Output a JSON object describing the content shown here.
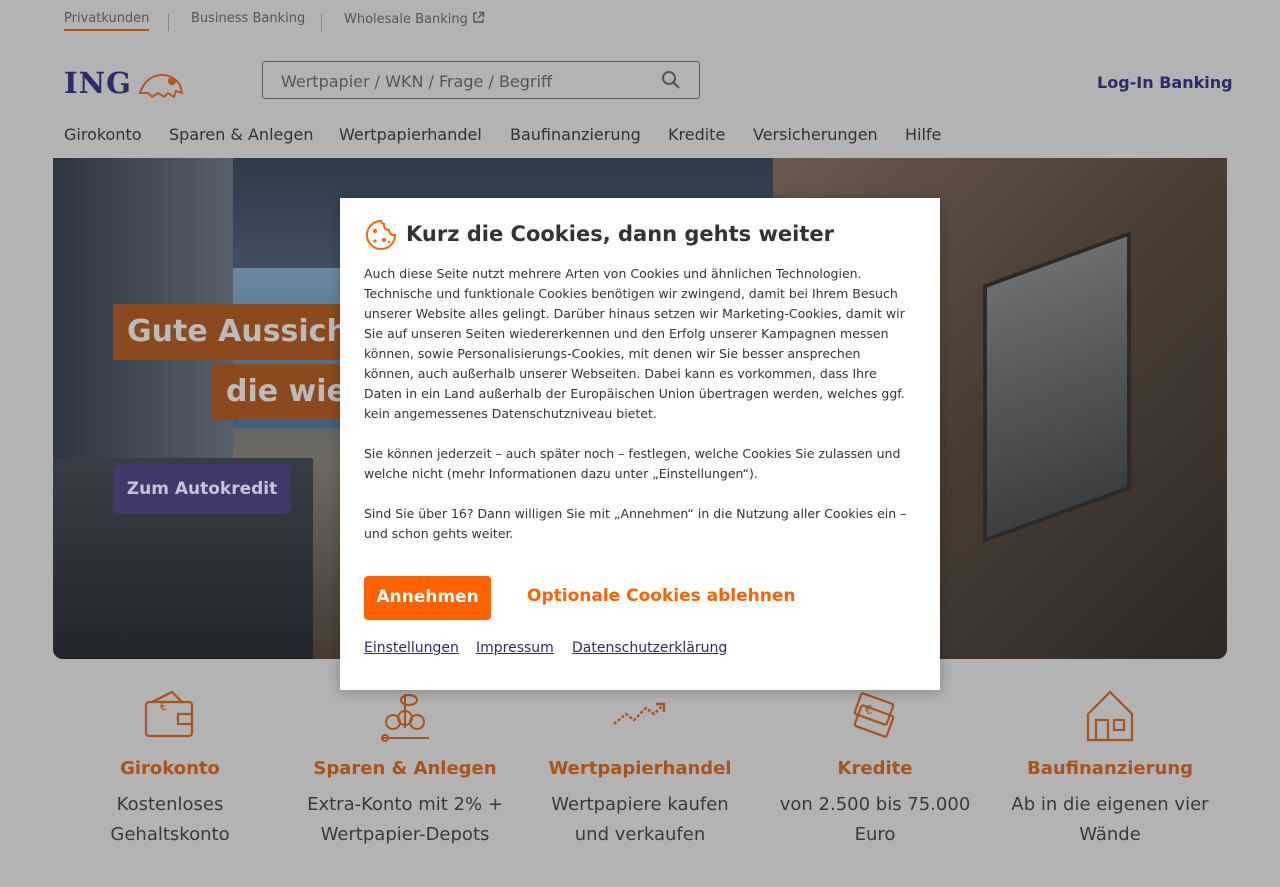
{
  "segments": {
    "items": [
      {
        "label": "Privatkunden"
      },
      {
        "label": "Business Banking"
      },
      {
        "label": "Wholesale Banking"
      }
    ]
  },
  "header": {
    "logo_text": "ING",
    "search_placeholder": "Wertpapier / WKN / Frage / Begriff",
    "login_label": "Log-In Banking"
  },
  "nav": {
    "items": [
      {
        "label": "Girokonto"
      },
      {
        "label": "Sparen & Anlegen"
      },
      {
        "label": "Wertpapierhandel"
      },
      {
        "label": "Baufinanzierung"
      },
      {
        "label": "Kredite"
      },
      {
        "label": "Versicherungen"
      },
      {
        "label": "Hilfe"
      }
    ]
  },
  "hero": {
    "headline_line1": "Gute Aussicht",
    "headline_line2": "die wie",
    "cta_label": "Zum Autokredit"
  },
  "products": [
    {
      "title": "Girokonto",
      "desc": "Kostenloses Gehaltskonto",
      "icon": "wallet-euro-icon"
    },
    {
      "title": "Sparen & Anlegen",
      "desc": "Extra-Konto mit 2% + Wertpapier-Depots",
      "icon": "savings-plant-icon"
    },
    {
      "title": "Wertpapierhandel",
      "desc": "Wertpapiere kaufen und verkaufen",
      "icon": "trend-up-icon"
    },
    {
      "title": "Kredite",
      "desc": "von 2.500 bis 75.000 Euro",
      "icon": "banknotes-icon"
    },
    {
      "title": "Baufinanzierung",
      "desc": "Ab in die eigenen vier Wände",
      "icon": "house-icon"
    }
  ],
  "cookie_modal": {
    "title": "Kurz die Cookies, dann gehts weiter",
    "paragraph1": "Auch diese Seite nutzt mehrere Arten von Cookies und ähnlichen Technologien. Technische und funktionale Cookies benötigen wir zwingend, damit bei Ihrem Besuch unserer Website alles gelingt. Darüber hinaus setzen wir Marketing-Cookies, damit wir Sie auf unseren Seiten wiedererkennen und den Erfolg unserer Kampagnen messen können, sowie Personalisierungs-Cookies, mit denen wir Sie besser ansprechen können, auch außerhalb unserer Webseiten. Dabei kann es vorkommen, dass Ihre Daten in ein Land außerhalb der Europäischen Union übertragen werden, welches ggf. kein angemessenes Datenschutzniveau bietet.",
    "paragraph2": "Sie können jederzeit – auch später noch – festlegen, welche Cookies Sie zulassen und welche nicht (mehr Informationen dazu unter „Einstellungen“).",
    "paragraph3": "Sind Sie über 16? Dann willigen Sie mit „Annehmen“ in die Nutzung aller Cookies ein – und schon gehts weiter.",
    "accept_label": "Annehmen",
    "decline_label": "Optionale Cookies ablehnen",
    "links": [
      {
        "label": "Einstellungen"
      },
      {
        "label": "Impressum"
      },
      {
        "label": "Datenschutzerklärung"
      }
    ]
  },
  "colors": {
    "accent": "#ff6200",
    "brand": "#2b2a6b",
    "overlay": "#b3b3b3"
  }
}
